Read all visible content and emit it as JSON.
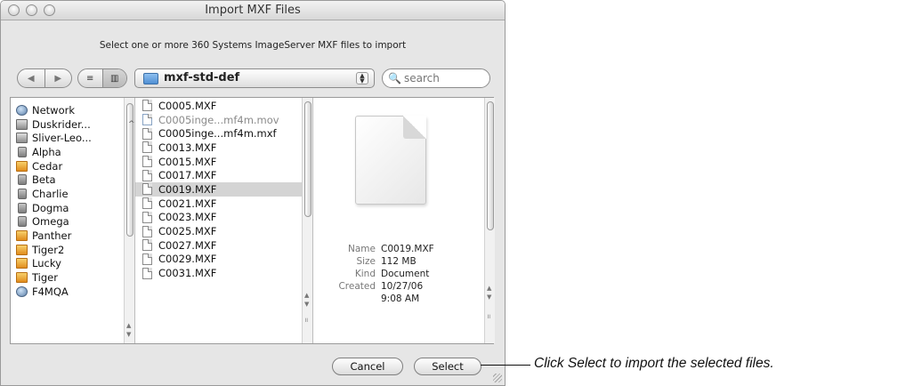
{
  "window": {
    "title": "Import MXF Files",
    "subtitle": "Select one or more 360 Systems ImageServer MXF files to import"
  },
  "toolbar": {
    "back_icon": "back-arrow-icon",
    "forward_icon": "forward-arrow-icon",
    "list_view_icon": "list-view-icon",
    "column_view_icon": "column-view-icon",
    "location": "mxf-std-def",
    "search_placeholder": "search"
  },
  "sidebar": {
    "items": [
      {
        "label": "Network",
        "icon": "network"
      },
      {
        "label": "Duskrider...",
        "icon": "computer"
      },
      {
        "label": "Sliver-Leo...",
        "icon": "computer"
      },
      {
        "label": "Alpha",
        "icon": "drive"
      },
      {
        "label": "Cedar",
        "icon": "home"
      },
      {
        "label": "Beta",
        "icon": "drive"
      },
      {
        "label": "Charlie",
        "icon": "drive"
      },
      {
        "label": "Dogma",
        "icon": "drive"
      },
      {
        "label": "Omega",
        "icon": "drive"
      },
      {
        "label": "Panther",
        "icon": "home"
      },
      {
        "label": "Tiger2",
        "icon": "home"
      },
      {
        "label": "Lucky",
        "icon": "home"
      },
      {
        "label": "Tiger",
        "icon": "home"
      },
      {
        "label": "F4MQA",
        "icon": "network"
      }
    ]
  },
  "files": {
    "items": [
      {
        "label": "C0005.MXF",
        "dim": false,
        "selected": false
      },
      {
        "label": "C0005inge...mf4m.mov",
        "dim": true,
        "selected": false
      },
      {
        "label": "C0005inge...mf4m.mxf",
        "dim": false,
        "selected": false
      },
      {
        "label": "C0013.MXF",
        "dim": false,
        "selected": false
      },
      {
        "label": "C0015.MXF",
        "dim": false,
        "selected": false
      },
      {
        "label": "C0017.MXF",
        "dim": false,
        "selected": false
      },
      {
        "label": "C0019.MXF",
        "dim": false,
        "selected": true
      },
      {
        "label": "C0021.MXF",
        "dim": false,
        "selected": false
      },
      {
        "label": "C0023.MXF",
        "dim": false,
        "selected": false
      },
      {
        "label": "C0025.MXF",
        "dim": false,
        "selected": false
      },
      {
        "label": "C0027.MXF",
        "dim": false,
        "selected": false
      },
      {
        "label": "C0029.MXF",
        "dim": false,
        "selected": false
      },
      {
        "label": "C0031.MXF",
        "dim": false,
        "selected": false
      }
    ]
  },
  "preview": {
    "name_label": "Name",
    "name_value": "C0019.MXF",
    "size_label": "Size",
    "size_value": "112 MB",
    "kind_label": "Kind",
    "kind_value": "Document",
    "created_label": "Created",
    "created_value": "10/27/06",
    "created_time": "9:08 AM"
  },
  "buttons": {
    "cancel": "Cancel",
    "select": "Select"
  },
  "annotation": "Click Select to import the selected files.",
  "colors": {
    "window_bg": "#e6e6e6",
    "selection": "#d4d4d4"
  }
}
